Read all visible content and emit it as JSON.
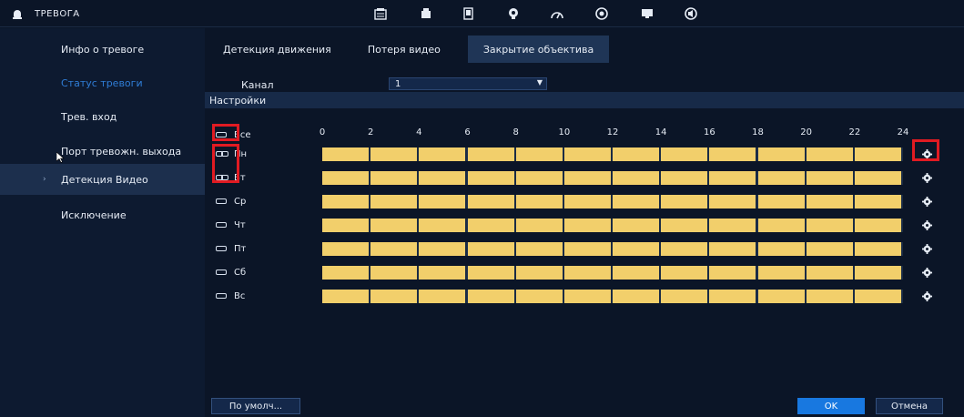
{
  "app": {
    "title": "ТРЕВОГА"
  },
  "top_icons": [
    "camera-icon",
    "network-icon",
    "storage-icon",
    "ai-icon",
    "speed-icon",
    "settings-icon",
    "display-icon",
    "audio-icon"
  ],
  "sidebar": {
    "items": [
      {
        "label": "Инфо о тревоге"
      },
      {
        "label": "Статус тревоги"
      },
      {
        "label": "Трев. вход"
      },
      {
        "label": "Порт тревожн. выхода"
      },
      {
        "label": "Детекция Видео"
      },
      {
        "label": "Исключение"
      }
    ]
  },
  "tabs": [
    {
      "label": "Детекция движения"
    },
    {
      "label": "Потеря видео"
    },
    {
      "label": "Закрытие объектива"
    }
  ],
  "channel": {
    "label": "Канал",
    "value": "1"
  },
  "settings": {
    "title": "Настройки"
  },
  "schedule": {
    "all_label": "Все",
    "hours": [
      "0",
      "2",
      "4",
      "6",
      "8",
      "10",
      "12",
      "14",
      "16",
      "18",
      "20",
      "22",
      "24"
    ],
    "days": [
      {
        "label": "Пн",
        "linked": true
      },
      {
        "label": "Вт",
        "linked": true
      },
      {
        "label": "Ср",
        "linked": false
      },
      {
        "label": "Чт",
        "linked": false
      },
      {
        "label": "Пт",
        "linked": false
      },
      {
        "label": "Сб",
        "linked": false
      },
      {
        "label": "Вс",
        "linked": false
      }
    ],
    "active_from_hour": 0,
    "active_to_hour": 24,
    "fill_color": "#f2cf6b"
  },
  "buttons": {
    "default": "По умолч...",
    "ok": "OK",
    "cancel": "Отмена"
  },
  "colors": {
    "accent": "#1878e0",
    "highlight": "#e11b22",
    "status_link": "#2f7dd6"
  }
}
